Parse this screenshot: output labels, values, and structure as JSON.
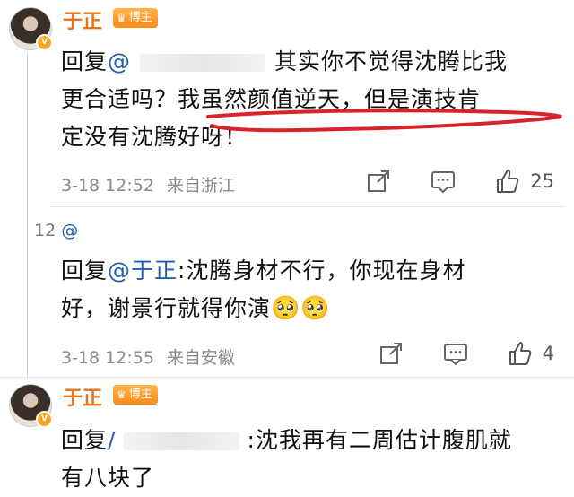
{
  "comments": [
    {
      "username": "于正",
      "badge": "博主",
      "reply_prefix": "回复",
      "mention": "@",
      "line1_rest": "其实你不觉得沈腾比我",
      "line2": "更合适吗？我虽然颜值逆天，但是演技肯",
      "line3": "定没有沈腾好呀！",
      "date": "3-18 12:52",
      "source": "来自浙江",
      "likes": "25"
    },
    {
      "floor_tag": "12",
      "mention": "@",
      "reply_prefix": "回复",
      "reply_mention": "@于正",
      "line1_rest": ":沈腾身材不行，你现在身材",
      "line2": "好，谢景行就得你演",
      "emoji": "🥺🥺",
      "date": "3-18 12:55",
      "source": "来自安徽",
      "likes": "4"
    },
    {
      "username": "于正",
      "badge": "博主",
      "reply_prefix": "回复",
      "mention": "/",
      "line1_rest": ":沈我再有二周估计腹肌就",
      "line2": "有八块了"
    }
  ],
  "colors": {
    "username": "#e8751a",
    "mention": "#1f5fb0",
    "underline": "#d9232a",
    "meta": "#8a8a8a"
  }
}
